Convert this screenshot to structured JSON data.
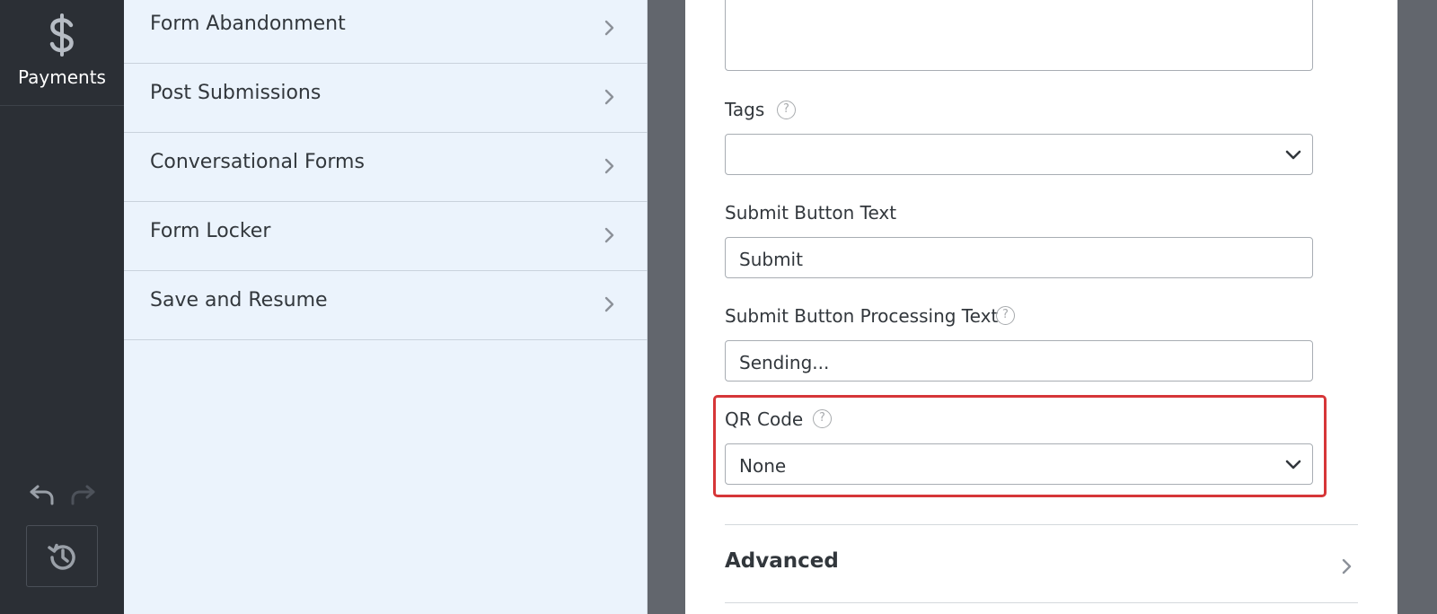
{
  "rail": {
    "payments_label": "Payments",
    "icons": [
      "dollar-icon",
      "undo-icon",
      "redo-icon",
      "history-icon"
    ]
  },
  "menu": {
    "items": [
      {
        "label": "Form Abandonment"
      },
      {
        "label": "Post Submissions"
      },
      {
        "label": "Conversational Forms"
      },
      {
        "label": "Form Locker"
      },
      {
        "label": "Save and Resume"
      }
    ]
  },
  "form": {
    "tags_label": "Tags",
    "tags_value": "",
    "submit_text_label": "Submit Button Text",
    "submit_text_value": "Submit",
    "processing_label": "Submit Button Processing Text",
    "processing_value": "Sending...",
    "qr_label": "QR Code",
    "qr_value": "None",
    "help_glyph": "?",
    "advanced_label": "Advanced"
  },
  "colors": {
    "highlight": "#d63638",
    "rail_bg": "#2b2f35",
    "menu_bg": "#ebf3fc"
  }
}
